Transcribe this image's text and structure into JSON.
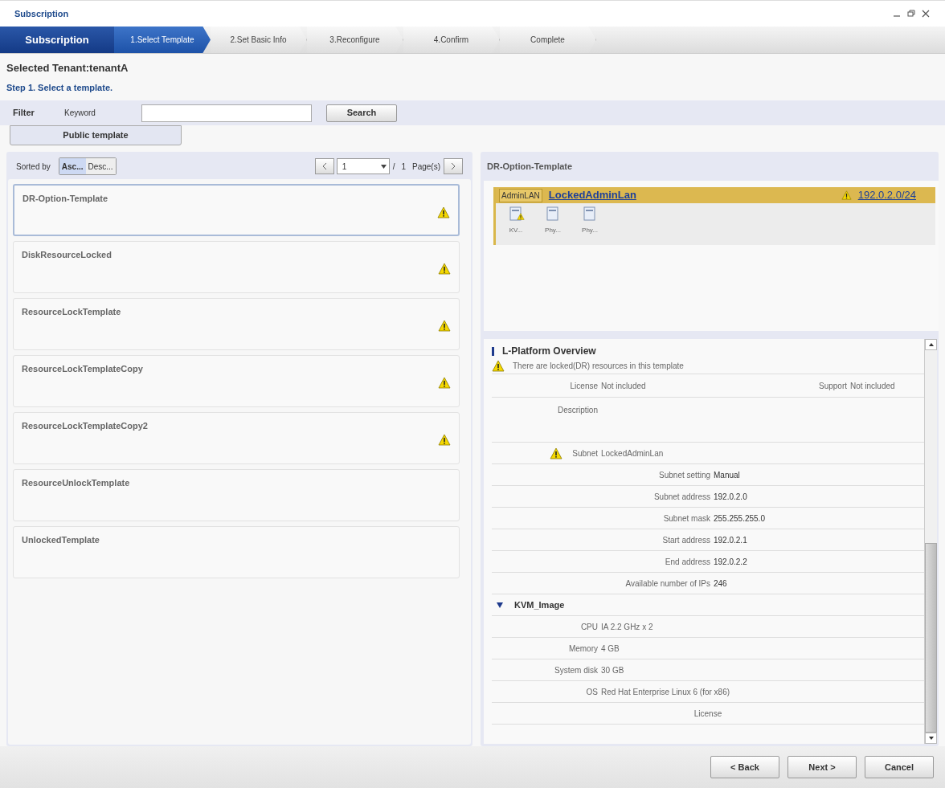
{
  "window": {
    "title": "Subscription"
  },
  "wizard": {
    "title": "Subscription",
    "steps": [
      {
        "label": "1.Select Template",
        "selected": true
      },
      {
        "label": "2.Set Basic Info",
        "selected": false
      },
      {
        "label": "3.Reconfigure",
        "selected": false
      },
      {
        "label": "4.Confirm",
        "selected": false
      },
      {
        "label": "Complete",
        "selected": false
      }
    ]
  },
  "tenant_label": "Selected Tenant:tenantA",
  "step_text": "Step 1. Select a template.",
  "filter": {
    "label": "Filter",
    "keyword_label": "Keyword",
    "search_button": "Search"
  },
  "template_tabs": [
    {
      "label": "Public template",
      "selected": true
    }
  ],
  "sort": {
    "label": "Sorted by",
    "options": [
      {
        "label": "Asc...",
        "selected": true
      },
      {
        "label": "Desc...",
        "selected": false
      }
    ]
  },
  "pager": {
    "page": "1",
    "separator": "/",
    "total": "1",
    "unit": "Page(s)"
  },
  "templates": [
    {
      "name": "DR-Option-Template",
      "warning": true,
      "selected": true
    },
    {
      "name": "DiskResourceLocked",
      "warning": true,
      "selected": false
    },
    {
      "name": "ResourceLockTemplate",
      "warning": true,
      "selected": false
    },
    {
      "name": "ResourceLockTemplateCopy",
      "warning": true,
      "selected": false
    },
    {
      "name": "ResourceLockTemplateCopy2",
      "warning": true,
      "selected": false
    },
    {
      "name": "ResourceUnlockTemplate",
      "warning": false,
      "selected": false
    },
    {
      "name": "UnlockedTemplate",
      "warning": false,
      "selected": false
    }
  ],
  "detail": {
    "title": "DR-Option-Template",
    "network": {
      "tag": "AdminLAN",
      "name": "LockedAdminLan",
      "warning": true,
      "address": "192.0.2.0/24",
      "servers": [
        {
          "label": "KV...",
          "warning": true
        },
        {
          "label": "Phy...",
          "warning": false
        },
        {
          "label": "Phy...",
          "warning": false
        }
      ]
    }
  },
  "overview": {
    "title": "L-Platform Overview",
    "warning_message": "There are locked(DR) resources in this template",
    "rows": [
      {
        "kind": "double",
        "label": "License",
        "value": "Not included",
        "label2": "Support",
        "value2": "Not included"
      },
      {
        "kind": "tall",
        "label": "Description"
      },
      {
        "kind": "field",
        "label": "Subnet",
        "value": "LockedAdminLan",
        "warning": true
      },
      {
        "kind": "sub",
        "label": "Subnet setting",
        "value": "Manual"
      },
      {
        "kind": "sub",
        "label": "Subnet address",
        "value": "192.0.2.0"
      },
      {
        "kind": "sub",
        "label": "Subnet mask",
        "value": "255.255.255.0"
      },
      {
        "kind": "sub",
        "label": "Start address",
        "value": "192.0.2.1"
      },
      {
        "kind": "sub",
        "label": "End address",
        "value": "192.0.2.2"
      },
      {
        "kind": "sub",
        "label": "Available number of IPs",
        "value": "246"
      },
      {
        "kind": "section",
        "label": "KVM_Image",
        "expanded": true
      },
      {
        "kind": "field",
        "label": "CPU",
        "value": "IA 2.2 GHz x 2",
        "warning": false
      },
      {
        "kind": "field",
        "label": "Memory",
        "value": "4 GB",
        "warning": false
      },
      {
        "kind": "field",
        "label": "System disk",
        "value": "30 GB",
        "warning": false
      },
      {
        "kind": "field",
        "label": "OS",
        "value": "Red Hat Enterprise Linux 6 (for x86)",
        "warning": false
      },
      {
        "kind": "center",
        "label": "License"
      }
    ]
  },
  "buttons": [
    "< Back",
    "Next >",
    "Cancel"
  ]
}
